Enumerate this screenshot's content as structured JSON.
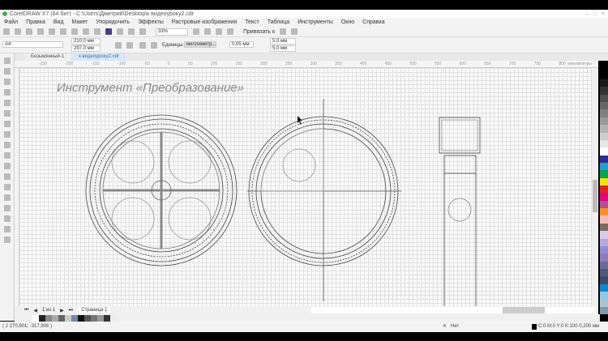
{
  "window": {
    "title": "CorelDRAW X7 (64 бит) - C:\\Users\\Дмитрий\\Desktop\\к видеоуроку2.cdr"
  },
  "menu": [
    "Файл",
    "Правка",
    "Вид",
    "Макет",
    "Упорядочить",
    "Эффекты",
    "Растровые изображения",
    "Текст",
    "Таблица",
    "Инструменты",
    "Окно",
    "Справка"
  ],
  "toolbar": {
    "zoom": "33%",
    "snap_label": "Привязать к"
  },
  "propbar": {
    "page_size": "A4",
    "width": "210,0 мм",
    "height": "297,0 мм",
    "units_label": "Единицы:",
    "units_value": "миллиметр...",
    "nudge": "0,05 мм",
    "dup_x": "5,0 мм",
    "dup_y": "5,0 мм"
  },
  "tabs": [
    {
      "label": "Безымянный-1"
    },
    {
      "label": "к видеоуроку2.cdr"
    }
  ],
  "ruler": {
    "unit": "миллиметры",
    "ticks": [
      "-250",
      "-200",
      "-150",
      "-100",
      "-50",
      "0",
      "50",
      "100",
      "150",
      "200",
      "250",
      "300",
      "350",
      "400",
      "450",
      "500",
      "550",
      "600",
      "650",
      "700",
      "750",
      "800"
    ]
  },
  "canvas": {
    "heading": "Инструмент «Преобразование»"
  },
  "pagenav": {
    "counter": "1 из 1",
    "page_tab": "Страница 1"
  },
  "status": {
    "coords": "( 2 270,901; -317,906 )",
    "fill_label": "Нет",
    "outline": "C:0 M:0 Y:0 K:100  0,200 мм"
  },
  "palette_colors": [
    "#1a1a1a",
    "#333",
    "#4d4d4d",
    "#666",
    "#808080",
    "#999",
    "#b3b3b3",
    "#ccc",
    "#e6e6e6",
    "#fff",
    "#2b2f8f",
    "#1ba0d8",
    "#00a651",
    "#f5e400",
    "#e2231a",
    "#e6007e",
    "#b84d9b",
    "#f7941d",
    "#f9b9b6",
    "#7a6b66",
    "#d6cce8",
    "#b8a9d9",
    "#8f8fd0",
    "#8c7bbf",
    "#6b6b9a",
    "#4d5a7a",
    "#3b4a6b",
    "#0f87c7",
    "#8fc9e8",
    "#a7c4d0",
    "#7d9aa8"
  ],
  "doc_palette": [
    "#fff",
    "#222",
    "#888",
    "#aaa",
    "#666",
    "#ccc",
    "#7788aa",
    "#111",
    "#555",
    "#777",
    "#999",
    "#333",
    "#eee"
  ]
}
